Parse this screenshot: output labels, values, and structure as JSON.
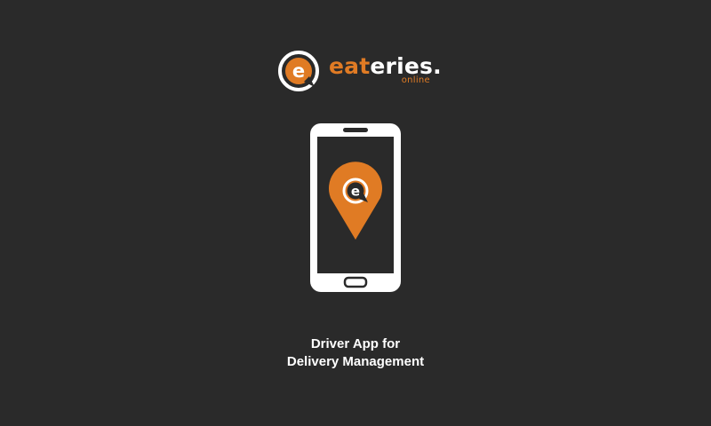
{
  "brand": {
    "name_accent": "eat",
    "name_rest": "eries.",
    "sub": "online",
    "accent_color": "#e07b24",
    "text_color": "#ffffff"
  },
  "illustration": {
    "device_icon": "smartphone-icon",
    "pin_icon": "location-pin-icon",
    "pin_letter": "e"
  },
  "tagline": {
    "line1": "Driver App for",
    "line2": "Delivery Management"
  },
  "theme": {
    "background": "#2a2a2a",
    "phone_color": "#ffffff",
    "screen_color": "#2a2a2a"
  }
}
